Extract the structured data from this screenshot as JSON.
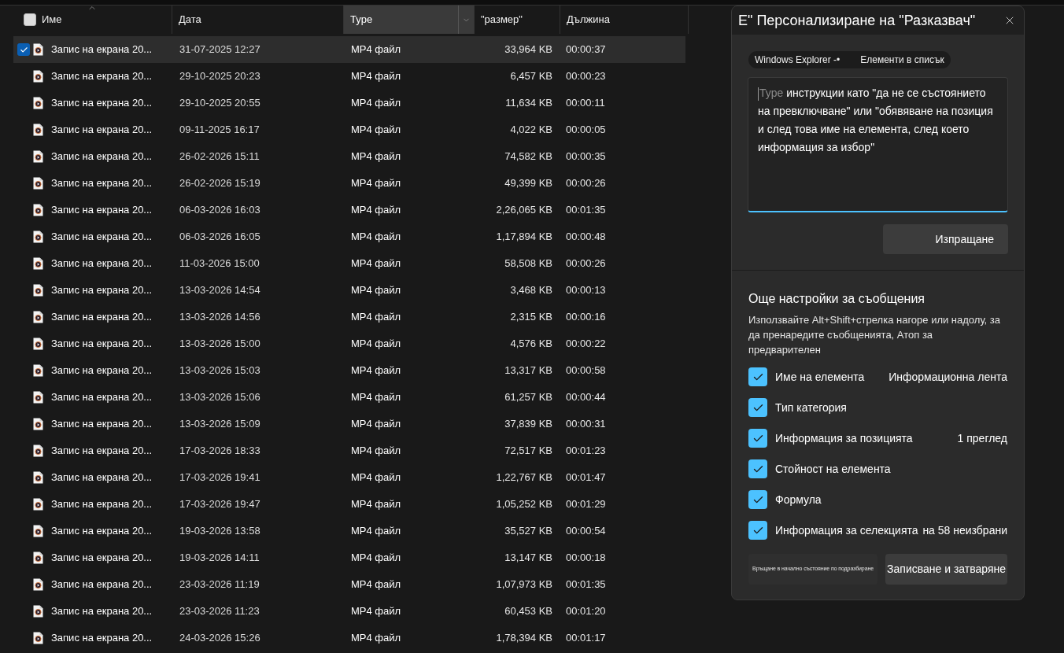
{
  "file_list": {
    "header_checkbox": {
      "checked": false
    },
    "columns": [
      {
        "label": "Име",
        "sorted": true,
        "selected": false
      },
      {
        "label": "Дата",
        "sorted": false,
        "selected": false
      },
      {
        "label": "Type",
        "sorted": false,
        "selected": true
      },
      {
        "label": "\"размер\"",
        "sorted": false,
        "selected": false
      },
      {
        "label": "Дължина",
        "sorted": false,
        "selected": false
      }
    ],
    "rows": [
      {
        "name": "Запис на екрана 20...",
        "date": "31-07-2025 12:27",
        "type": "MP4 файл",
        "size": "33,964 KB",
        "length": "00:00:37",
        "selected": true
      },
      {
        "name": "Запис на екрана 20...",
        "date": "29-10-2025 20:23",
        "type": "MP4 файл",
        "size": "6,457 KB",
        "length": "00:00:23",
        "selected": false
      },
      {
        "name": "Запис на екрана 20...",
        "date": "29-10-2025 20:55",
        "type": "MP4 файл",
        "size": "11,634 KB",
        "length": "00:00:11",
        "selected": false
      },
      {
        "name": "Запис на екрана 20...",
        "date": "09-11-2025 16:17",
        "type": "MP4 файл",
        "size": "4,022 KB",
        "length": "00:00:05",
        "selected": false
      },
      {
        "name": "Запис на екрана 20...",
        "date": "26-02-2026 15:11",
        "type": "MP4 файл",
        "size": "74,582 KB",
        "length": "00:00:35",
        "selected": false
      },
      {
        "name": "Запис на екрана 20...",
        "date": "26-02-2026 15:19",
        "type": "MP4 файл",
        "size": "49,399 KB",
        "length": "00:00:26",
        "selected": false
      },
      {
        "name": "Запис на екрана 20...",
        "date": "06-03-2026 16:03",
        "type": "MP4 файл",
        "size": "2,26,065 KB",
        "length": "00:01:35",
        "selected": false
      },
      {
        "name": "Запис на екрана 20...",
        "date": "06-03-2026 16:05",
        "type": "MP4 файл",
        "size": "1,17,894 KB",
        "length": "00:00:48",
        "selected": false
      },
      {
        "name": "Запис на екрана 20...",
        "date": "11-03-2026 15:00",
        "type": "MP4 файл",
        "size": "58,508 KB",
        "length": "00:00:26",
        "selected": false
      },
      {
        "name": "Запис на екрана 20...",
        "date": "13-03-2026 14:54",
        "type": "MP4 файл",
        "size": "3,468 KB",
        "length": "00:00:13",
        "selected": false
      },
      {
        "name": "Запис на екрана 20...",
        "date": "13-03-2026 14:56",
        "type": "MP4 файл",
        "size": "2,315 KB",
        "length": "00:00:16",
        "selected": false
      },
      {
        "name": "Запис на екрана 20...",
        "date": "13-03-2026 15:00",
        "type": "MP4 файл",
        "size": "4,576 KB",
        "length": "00:00:22",
        "selected": false
      },
      {
        "name": "Запис на екрана 20...",
        "date": "13-03-2026 15:03",
        "type": "MP4 файл",
        "size": "13,317 KB",
        "length": "00:00:58",
        "selected": false
      },
      {
        "name": "Запис на екрана 20...",
        "date": "13-03-2026 15:06",
        "type": "MP4 файл",
        "size": "61,257 KB",
        "length": "00:00:44",
        "selected": false
      },
      {
        "name": "Запис на екрана 20...",
        "date": "13-03-2026 15:09",
        "type": "MP4 файл",
        "size": "37,839 KB",
        "length": "00:00:31",
        "selected": false
      },
      {
        "name": "Запис на екрана 20...",
        "date": "17-03-2026 18:33",
        "type": "MP4 файл",
        "size": "72,517 KB",
        "length": "00:01:23",
        "selected": false
      },
      {
        "name": "Запис на екрана 20...",
        "date": "17-03-2026 19:41",
        "type": "MP4 файл",
        "size": "1,22,767 KB",
        "length": "00:01:47",
        "selected": false
      },
      {
        "name": "Запис на екрана 20...",
        "date": "17-03-2026 19:47",
        "type": "MP4 файл",
        "size": "1,05,252 KB",
        "length": "00:01:29",
        "selected": false
      },
      {
        "name": "Запис на екрана 20...",
        "date": "19-03-2026 13:58",
        "type": "MP4 файл",
        "size": "35,527 KB",
        "length": "00:00:54",
        "selected": false
      },
      {
        "name": "Запис на екрана 20...",
        "date": "19-03-2026 14:11",
        "type": "MP4 файл",
        "size": "13,147 KB",
        "length": "00:00:18",
        "selected": false
      },
      {
        "name": "Запис на екрана 20...",
        "date": "23-03-2026 11:19",
        "type": "MP4 файл",
        "size": "1,07,973 KB",
        "length": "00:01:35",
        "selected": false
      },
      {
        "name": "Запис на екрана 20...",
        "date": "23-03-2026 11:23",
        "type": "MP4 файл",
        "size": "60,453 KB",
        "length": "00:01:20",
        "selected": false
      },
      {
        "name": "Запис на екрана 20...",
        "date": "24-03-2026 15:26",
        "type": "MP4 файл",
        "size": "1,78,394 KB",
        "length": "00:01:17",
        "selected": false
      }
    ]
  },
  "narrator_panel": {
    "title": "E\" Персонализиране на \"Разказвач\"",
    "context_chips": [
      "Windows Explorer -•",
      "Елементи в списък"
    ],
    "instructions": {
      "placeholder": "Type",
      "value": "инструкции като \"да не се състоянието на превключване\" или \"обявяване на позиция и след това име на елемента, след което информация за избор\""
    },
    "send_button": "Изпращане",
    "section_title": "Още настройки за съобщения",
    "section_hint": "Използвайте Alt+Shift+стрелка нагоре или надолу, за да пренаредите съобщенията, Атоп за предварителен",
    "options": [
      {
        "label": "Име на елемента",
        "checked": true,
        "note": "Информационна лента"
      },
      {
        "label": "Тип категория",
        "checked": true
      },
      {
        "label": "Информация за позицията",
        "checked": true,
        "note": "1 преглед"
      },
      {
        "label": "Стойност на елемента",
        "checked": true
      },
      {
        "label": "Формула",
        "checked": true
      },
      {
        "label": "Информация за селекцията",
        "checked": true,
        "note": "на 58 неизбрани"
      }
    ],
    "buttons": [
      {
        "label": "Връщане в начално състояние по подразбиране",
        "kind": "reset"
      },
      {
        "label": "Записване и затваряне",
        "kind": "save"
      }
    ]
  }
}
